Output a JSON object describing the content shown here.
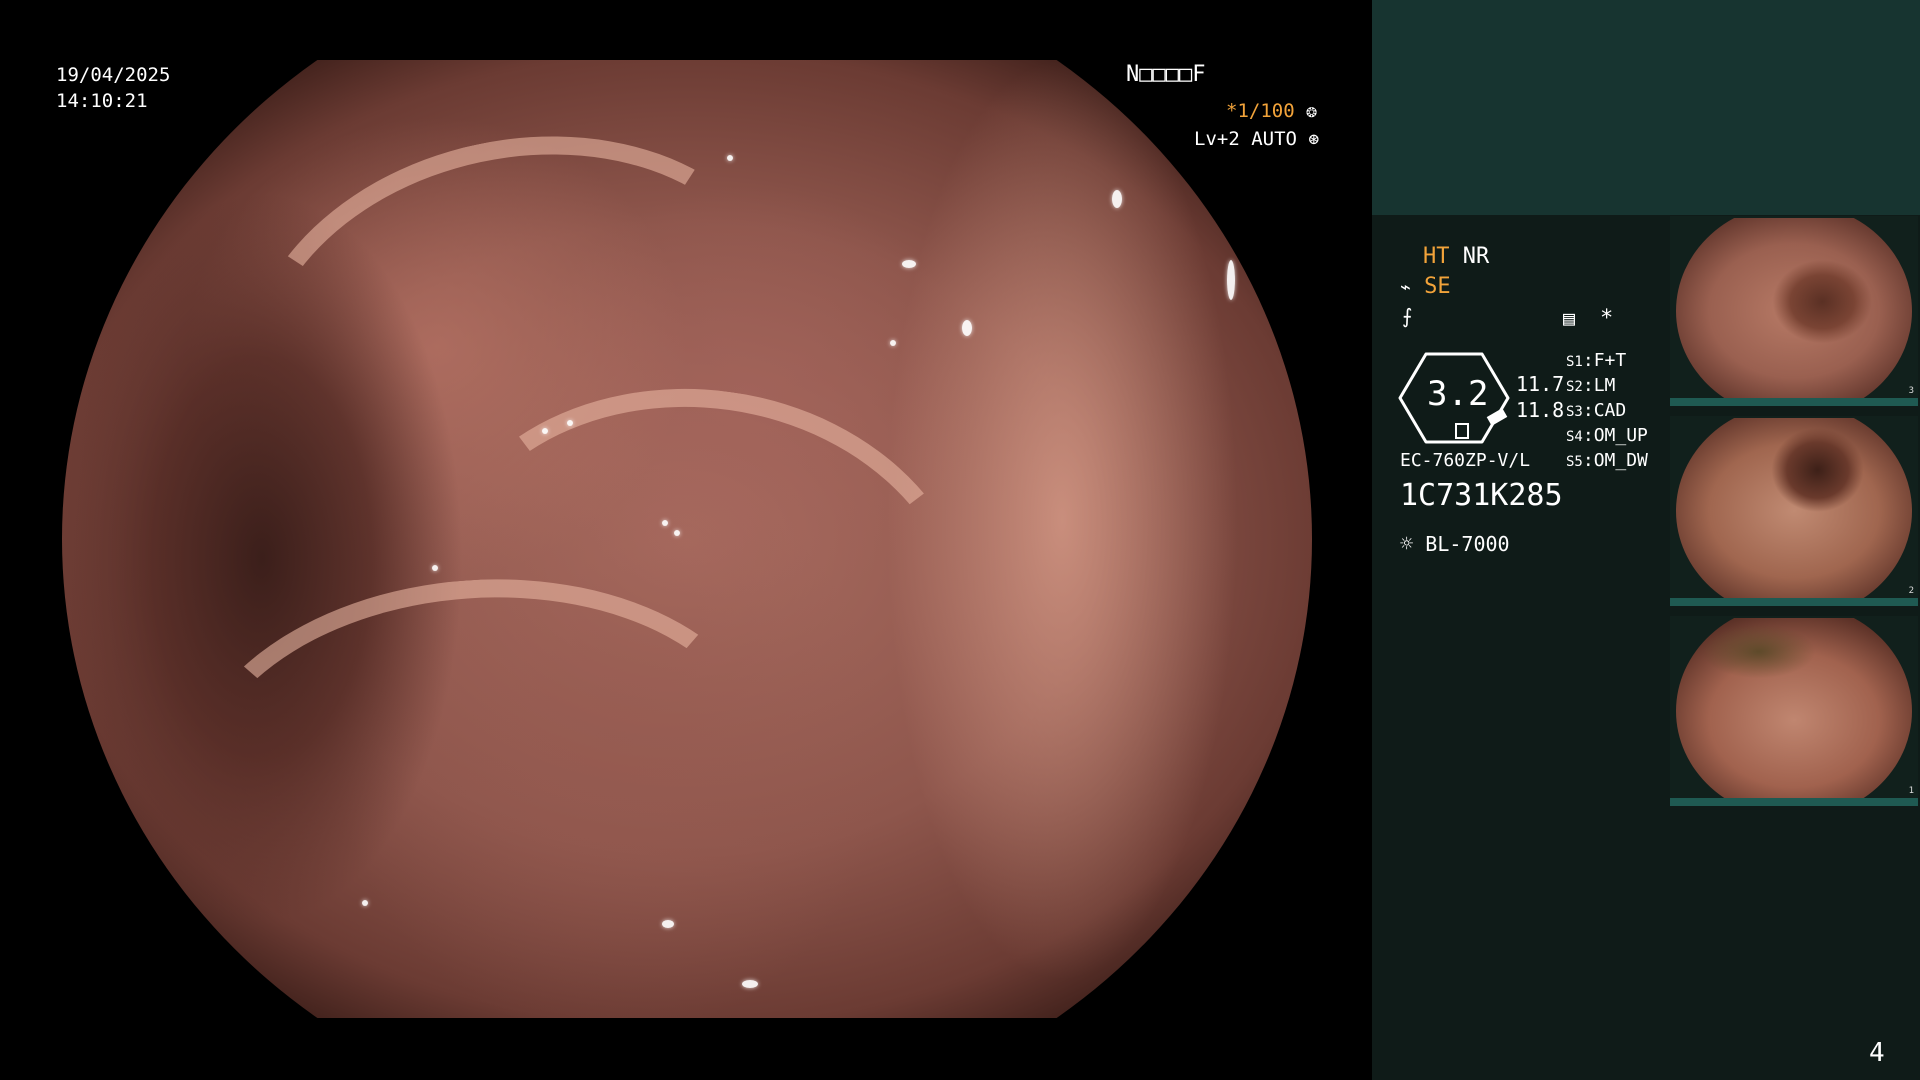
{
  "overlay": {
    "date": "19/04/2025",
    "time": "14:10:21",
    "code": "N□□□□F",
    "shutter": "*1/100",
    "shutter_icon": "aperture-icon",
    "level": "Lv+2 AUTO",
    "auto_icon": "auto-iris-icon"
  },
  "info_panel": {
    "ht": "HT",
    "nr": "NR",
    "se": "SE",
    "enhance_icon": "enhance-icon",
    "structure_icon": "structure-icon",
    "grid_icon": "grid-menu-icon",
    "star": "*",
    "scope_value": "3.2",
    "val1": "11.7",
    "val2": "11.8",
    "scope_model": "EC-760ZP-V/L",
    "serial": "1C731K285",
    "light_icon": "light-source-icon",
    "light_source": "BL-7000",
    "switches": [
      {
        "key": "S1",
        "value": "F+T"
      },
      {
        "key": "S2",
        "value": "LM"
      },
      {
        "key": "S3",
        "value": "CAD"
      },
      {
        "key": "S4",
        "value": "OM_UP"
      },
      {
        "key": "S5",
        "value": "OM_DW"
      }
    ]
  },
  "thumbnails": [
    {
      "index": "3"
    },
    {
      "index": "2"
    },
    {
      "index": "1"
    }
  ],
  "page_counter": "4",
  "colors": {
    "accent": "#f2a33a",
    "panel_bg": "#0f1b18",
    "panel_top": "#173430",
    "thumb_bar": "#1f5a52"
  }
}
